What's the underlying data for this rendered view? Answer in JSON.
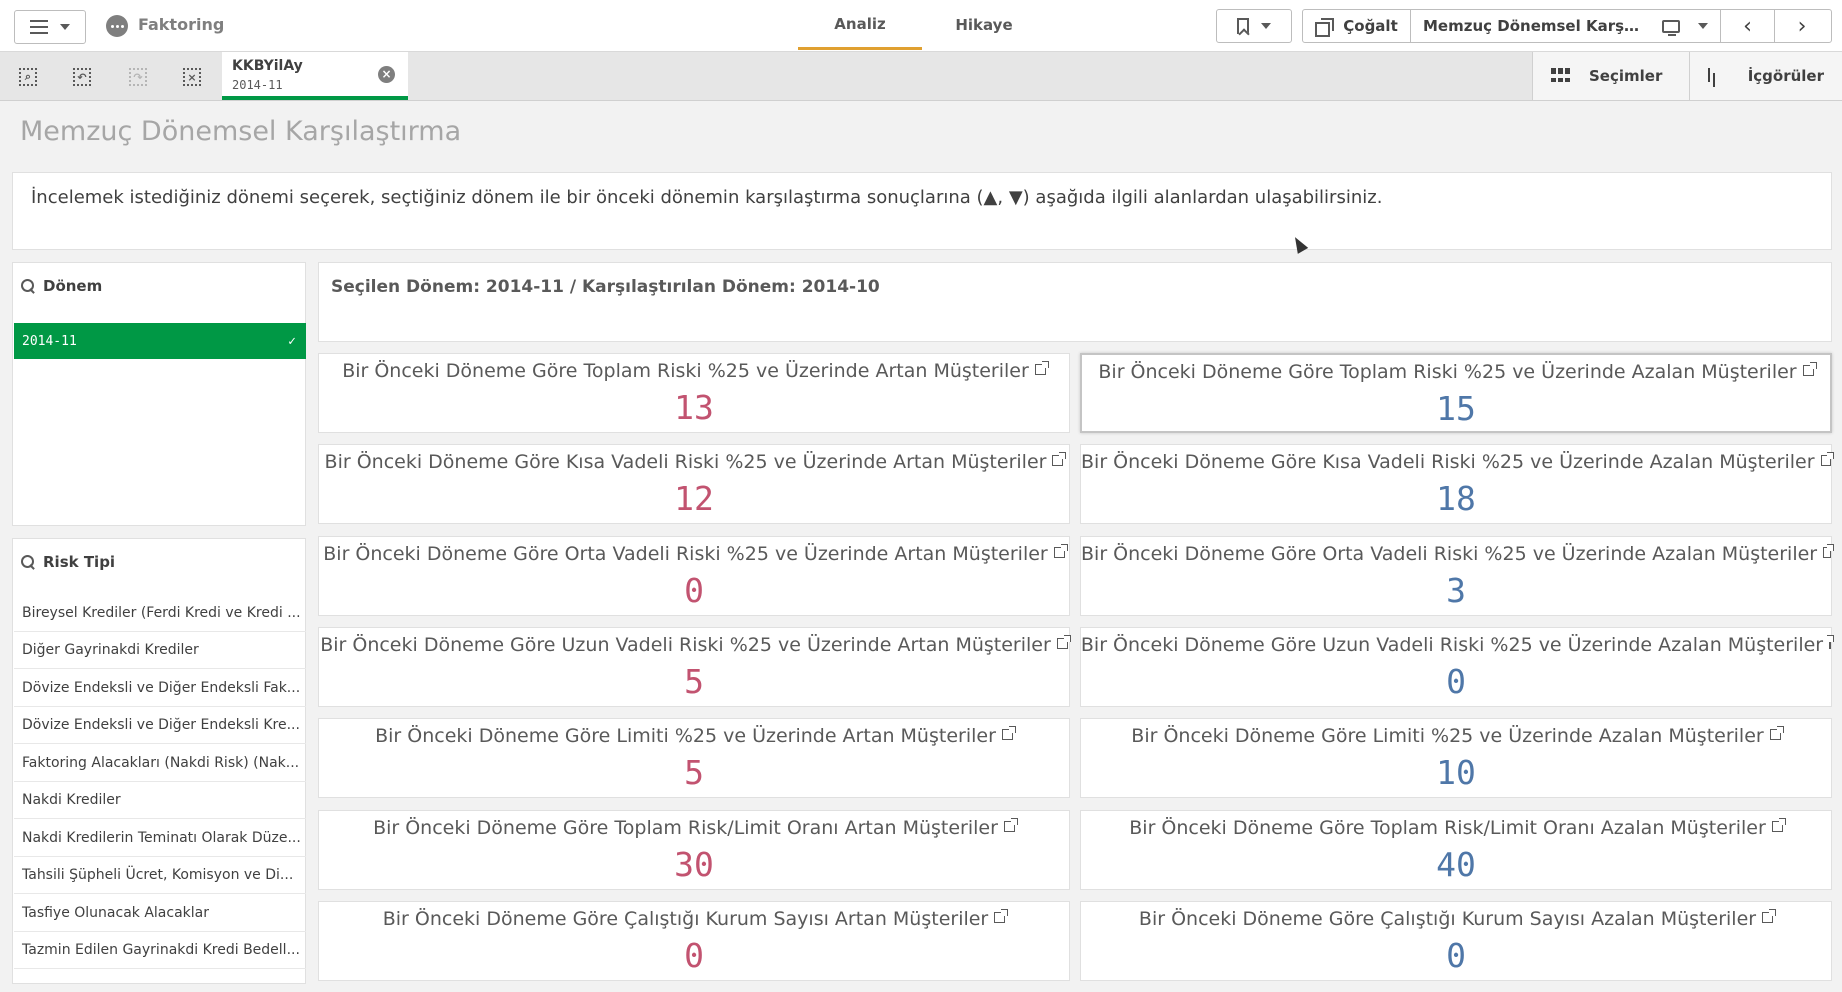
{
  "app": {
    "name": "Faktoring"
  },
  "nav": {
    "tabs": [
      {
        "label": "Analiz"
      },
      {
        "label": "Hikaye"
      }
    ]
  },
  "toolbar": {
    "duplicate_label": "Çoğalt",
    "sheet_selector": "Memzuç Dönemsel Karşılaşt..."
  },
  "selection_chip": {
    "field": "KKBYilAy",
    "value": "2014-11"
  },
  "selbar_right": {
    "selections_label": "Seçimler",
    "insights_label": "İçgörüler"
  },
  "sheet": {
    "title": "Memzuç Dönemsel Karşılaştırma",
    "info": "İncelemek istediğiniz dönemi seçerek, seçtiğiniz dönem ile bir önceki dönemin karşılaştırma sonuçlarına (▲, ▼) aşağıda ilgili alanlardan ulaşabilirsiniz."
  },
  "filters": {
    "donem": {
      "title": "Dönem",
      "selected": "2014-11"
    },
    "risk_tipi": {
      "title": "Risk Tipi",
      "items": [
        "Bireysel Krediler (Ferdi Kredi ve Kredi ...",
        "Diğer Gayrinakdi Krediler",
        "Dövize Endeksli ve Diğer Endeksli Fak...",
        "Dövize Endeksli ve Diğer Endeksli Kre...",
        "Faktoring Alacakları (Nakdi Risk) (Nak...",
        "Nakdi Krediler",
        "Nakdi Kredilerin Teminatı Olarak Düze...",
        "Tahsili Şüpheli Ücret, Komisyon ve Di...",
        "Tasfiye Olunacak Alacaklar",
        "Tazmin Edilen Gayrinakdi Kredi Bedell..."
      ]
    }
  },
  "selection_heading": "Seçilen Dönem: 2014-11 / Karşılaştırılan Dönem: 2014-10",
  "kpis": [
    {
      "label": "Bir Önceki Döneme Göre Toplam Riski %25 ve Üzerinde Artan Müşteriler",
      "value": "13",
      "trend": "up"
    },
    {
      "label": "Bir Önceki Döneme Göre Toplam Riski %25 ve Üzerinde Azalan Müşteriler",
      "value": "15",
      "trend": "down"
    },
    {
      "label": "Bir Önceki Döneme Göre Kısa Vadeli Riski %25 ve Üzerinde Artan Müşteriler",
      "value": "12",
      "trend": "up"
    },
    {
      "label": "Bir Önceki Döneme Göre Kısa Vadeli Riski %25 ve Üzerinde Azalan Müşteriler",
      "value": "18",
      "trend": "down"
    },
    {
      "label": "Bir Önceki Döneme Göre Orta Vadeli Riski %25 ve Üzerinde Artan Müşteriler",
      "value": "0",
      "trend": "up"
    },
    {
      "label": "Bir Önceki Döneme Göre Orta Vadeli Riski %25 ve Üzerinde Azalan Müşteriler",
      "value": "3",
      "trend": "down"
    },
    {
      "label": "Bir Önceki Döneme Göre Uzun Vadeli Riski %25 ve Üzerinde Artan Müşteriler",
      "value": "5",
      "trend": "up"
    },
    {
      "label": "Bir Önceki Döneme Göre Uzun Vadeli Riski %25 ve Üzerinde Azalan Müşteriler",
      "value": "0",
      "trend": "down"
    },
    {
      "label": "Bir Önceki Döneme Göre Limiti %25 ve Üzerinde Artan Müşteriler",
      "value": "5",
      "trend": "up"
    },
    {
      "label": "Bir Önceki Döneme Göre Limiti %25 ve Üzerinde Azalan Müşteriler",
      "value": "10",
      "trend": "down"
    },
    {
      "label": "Bir Önceki Döneme Göre Toplam Risk/Limit Oranı Artan Müşteriler",
      "value": "30",
      "trend": "up"
    },
    {
      "label": "Bir Önceki Döneme Göre Toplam Risk/Limit Oranı Azalan Müşteriler",
      "value": "40",
      "trend": "down"
    },
    {
      "label": "Bir Önceki Döneme Göre Çalıştığı Kurum Sayısı Artan Müşteriler",
      "value": "0",
      "trend": "up"
    },
    {
      "label": "Bir Önceki Döneme Göre Çalıştığı Kurum Sayısı Azalan Müşteriler",
      "value": "0",
      "trend": "down"
    }
  ],
  "colors": {
    "selected_green": "#009845",
    "increase": "#c25370",
    "decrease": "#4f77a8",
    "tab_underline": "#e0a030"
  }
}
